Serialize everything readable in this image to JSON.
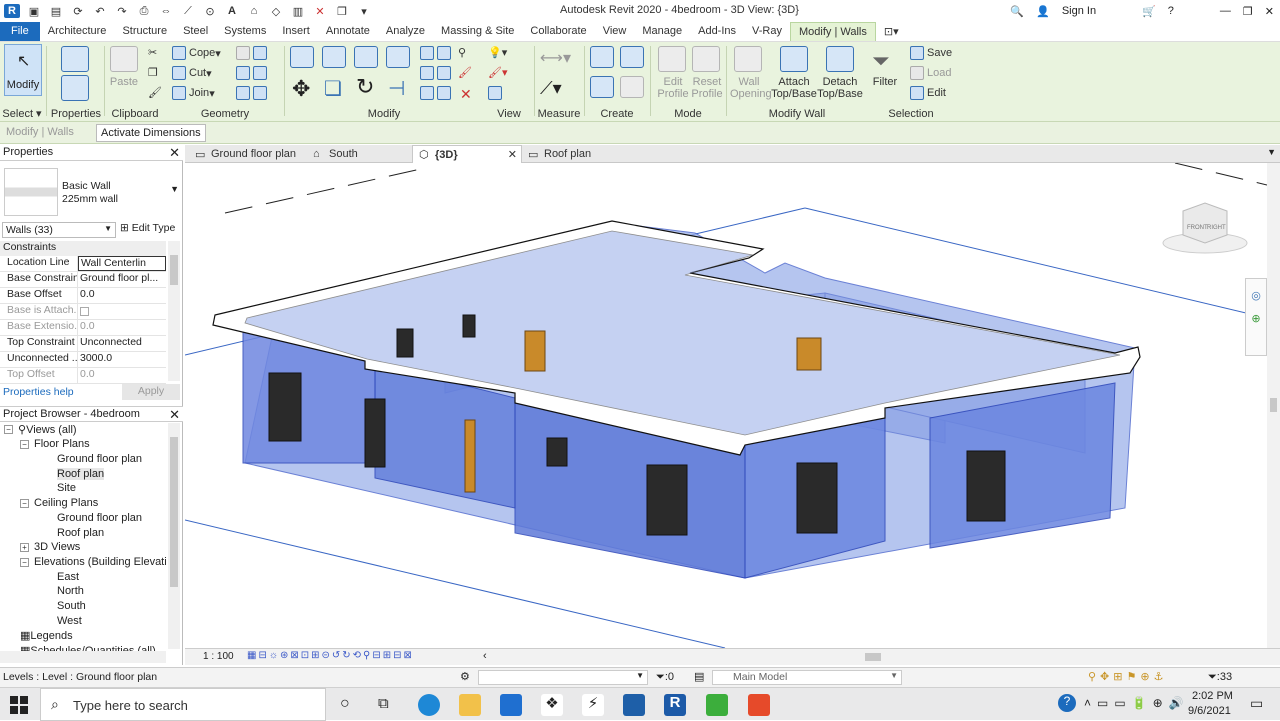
{
  "window": {
    "title": "Autodesk Revit 2020 - 4bedroom - 3D View: {3D}",
    "sign_in": "Sign In"
  },
  "menubar": {
    "tabs": [
      "File",
      "Architecture",
      "Structure",
      "Steel",
      "Systems",
      "Insert",
      "Annotate",
      "Analyze",
      "Massing & Site",
      "Collaborate",
      "View",
      "Manage",
      "Add-Ins",
      "V-Ray",
      "Modify | Walls"
    ]
  },
  "ribbon": {
    "modify_label": "Modify",
    "paste_label": "Paste",
    "cope_label": "Cope",
    "cut_label": "Cut",
    "join_label": "Join",
    "edit_profile_label": "Edit Profile",
    "reset_profile_label": "Reset Profile",
    "wall_opening_label": "Wall Opening",
    "attach_label": "Attach Top/Base",
    "detach_label": "Detach Top/Base",
    "filter_label": "Filter",
    "save_label": "Save",
    "load_label": "Load",
    "edit_label": "Edit",
    "groups": {
      "select": "Select",
      "properties": "Properties",
      "clipboard": "Clipboard",
      "geometry": "Geometry",
      "modify": "Modify",
      "view": "View",
      "measure": "Measure",
      "create": "Create",
      "mode": "Mode",
      "modify_wall": "Modify Wall",
      "selection": "Selection"
    }
  },
  "optbar": {
    "context": "Modify | Walls",
    "activate_dimensions": "Activate Dimensions"
  },
  "properties": {
    "title": "Properties",
    "family": "Basic Wall",
    "type": "225mm wall",
    "selector": "Walls (33)",
    "edit_type": "Edit Type",
    "section": "Constraints",
    "rows": [
      {
        "k": "Location Line",
        "v": "Wall Centerlin"
      },
      {
        "k": "Base Constraint",
        "v": "Ground floor pl..."
      },
      {
        "k": "Base Offset",
        "v": "0.0"
      },
      {
        "k": "Base is Attach...",
        "v": ""
      },
      {
        "k": "Base Extensio...",
        "v": "0.0"
      },
      {
        "k": "Top Constraint",
        "v": "Unconnected"
      },
      {
        "k": "Unconnected ...",
        "v": "3000.0"
      },
      {
        "k": "Top Offset",
        "v": "0.0"
      }
    ],
    "help": "Properties help",
    "apply": "Apply"
  },
  "browser": {
    "title": "Project Browser - 4bedroom",
    "nodes": [
      "Views (all)",
      "Floor Plans",
      "Ground floor plan",
      "Roof plan",
      "Site",
      "Ceiling Plans",
      "Ground floor plan",
      "Roof plan",
      "3D Views",
      "Elevations (Building Elevatio",
      "East",
      "North",
      "South",
      "West",
      "Legends",
      "Schedules/Quantities (all)"
    ]
  },
  "view_tabs": [
    "Ground floor plan",
    "South",
    "{3D}",
    "Roof plan"
  ],
  "viewbar": {
    "scale": "1 : 100"
  },
  "viewcube": {
    "front": "FRONT",
    "right": "RIGHT"
  },
  "statusbar": {
    "level_text": "Levels : Level : Ground floor plan",
    "zero": ":0",
    "model": "Main Model",
    "filter_count": "33"
  },
  "taskbar": {
    "search_placeholder": "Type here to search",
    "time": "2:02 PM",
    "date": "9/6/2021"
  }
}
